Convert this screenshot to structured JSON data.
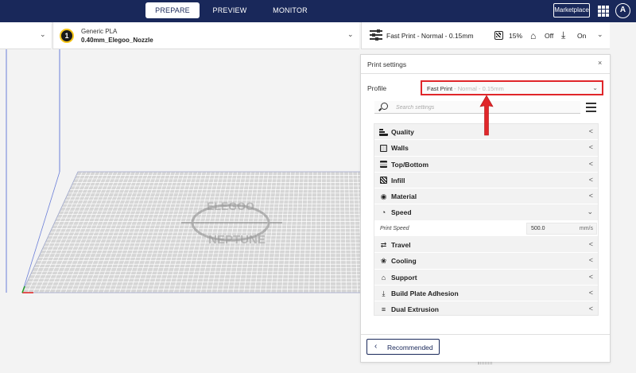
{
  "topbar": {
    "tabs": [
      {
        "label": "PREPARE",
        "active": true
      },
      {
        "label": "PREVIEW",
        "active": false
      },
      {
        "label": "MONITOR",
        "active": false
      }
    ],
    "marketplace_label": "Marketplace",
    "account_initial": "A"
  },
  "extruder": {
    "number": "1",
    "material": "Generic PLA",
    "nozzle": "0.40mm_Elegoo_Nozzle"
  },
  "print_summary": {
    "profile": "Fast Print - Normal - 0.15mm",
    "infill": "15%",
    "support": "Off",
    "adhesion": "On"
  },
  "print_settings": {
    "title": "Print settings",
    "close_glyph": "×",
    "profile_label": "Profile",
    "profile_value_main": "Fast Print",
    "profile_value_sub": " - Normal - 0.15mm",
    "search_placeholder": "Search settings",
    "categories": [
      {
        "label": "Quality",
        "icon": "quality-icon",
        "chevron": "<"
      },
      {
        "label": "Walls",
        "icon": "walls-icon",
        "chevron": "<"
      },
      {
        "label": "Top/Bottom",
        "icon": "top-bottom-icon",
        "chevron": "<"
      },
      {
        "label": "Infill",
        "icon": "infill-icon",
        "chevron": "<"
      },
      {
        "label": "Material",
        "icon": "material-icon",
        "chevron": "<"
      },
      {
        "label": "Speed",
        "icon": "speed-icon",
        "chevron": "⌄"
      },
      {
        "label": "Travel",
        "icon": "travel-icon",
        "chevron": "<"
      },
      {
        "label": "Cooling",
        "icon": "cooling-icon",
        "chevron": "<"
      },
      {
        "label": "Support",
        "icon": "support-icon",
        "chevron": "<"
      },
      {
        "label": "Build Plate Adhesion",
        "icon": "adhesion-icon",
        "chevron": "<"
      },
      {
        "label": "Dual Extrusion",
        "icon": "dual-extrusion-icon",
        "chevron": "<"
      }
    ],
    "print_speed": {
      "label": "Print Speed",
      "value": "500.0",
      "unit": "mm/s"
    },
    "recommended_label": "Recommended"
  },
  "build_plate": {
    "logo_text_top": "ELEGOO",
    "logo_text_bottom": "NEPTUNE"
  },
  "colors": {
    "topbar": "#19285a",
    "highlight": "#e0262a",
    "plate": "#d9d9d9"
  }
}
